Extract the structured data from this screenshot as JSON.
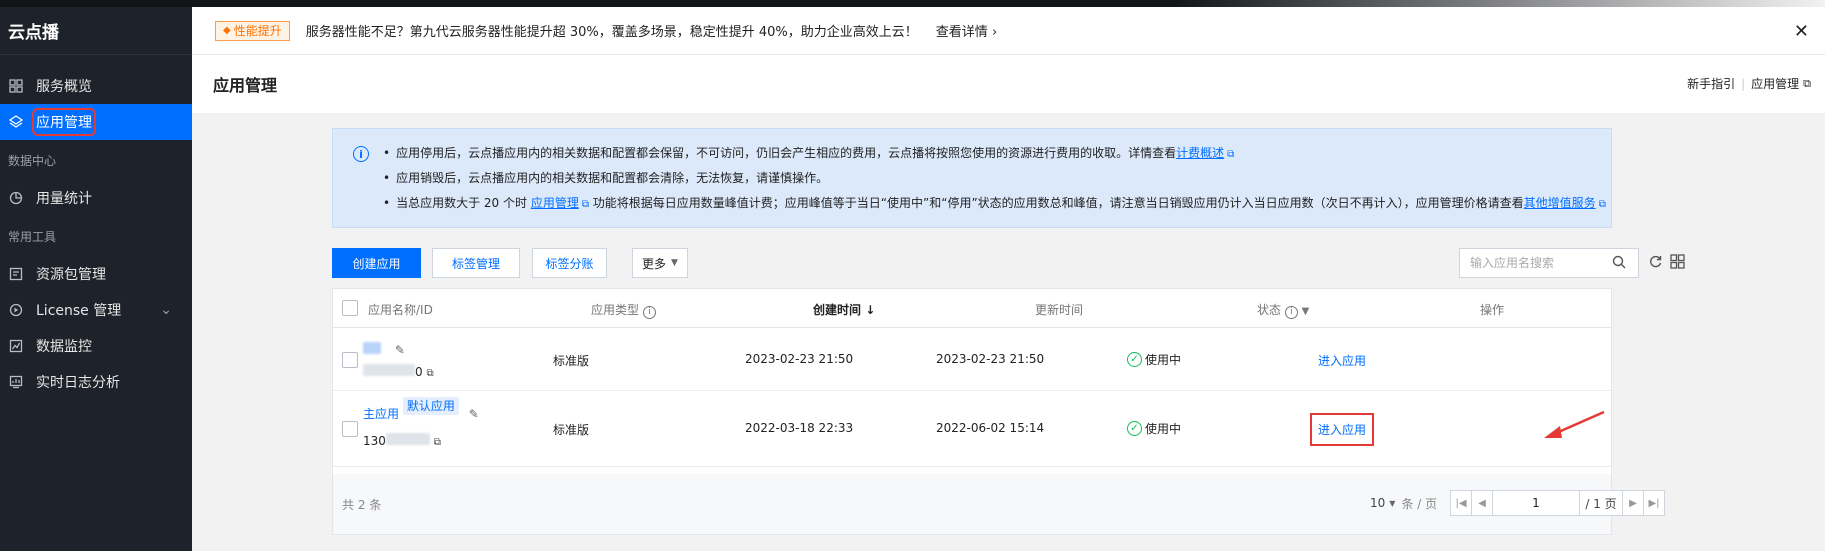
{
  "sidebar": {
    "brand": "云点播",
    "items": [
      {
        "label": "服务概览",
        "icon": "grid-icon"
      },
      {
        "label": "应用管理",
        "icon": "layers-icon",
        "active": true
      }
    ],
    "group_data": "数据中心",
    "data_items": [
      {
        "label": "用量统计",
        "icon": "pie-icon"
      }
    ],
    "group_tools": "常用工具",
    "tool_items": [
      {
        "label": "资源包管理",
        "icon": "package-icon"
      },
      {
        "label": "License 管理",
        "icon": "license-icon"
      },
      {
        "label": "数据监控",
        "icon": "monitor-icon"
      },
      {
        "label": "实时日志分析",
        "icon": "log-icon"
      }
    ]
  },
  "banner": {
    "badge": "性能提升",
    "message": "服务器性能不足？第九代云服务器性能提升超 30%，覆盖多场景，稳定性提升 40%，助力企业高效上云！",
    "detail": "查看详情",
    "close": "✕"
  },
  "header": {
    "title": "应用管理",
    "link_guide": "新手指引",
    "link_manage": "应用管理"
  },
  "notice": {
    "line1_text": "应用停用后，云点播应用内的相关数据和配置都会保留，不可访问，仍旧会产生相应的费用，云点播将按照您使用的资源进行费用的收取。详情查看",
    "line1_link": "计费概述",
    "line2_text": "应用销毁后，云点播应用内的相关数据和配置都会清除，无法恢复，请谨慎操作。",
    "line3_text_a": "当总应用数大于 20 个时",
    "line3_link_a": "应用管理",
    "line3_text_b": "功能将根据每日应用数量峰值计费；应用峰值等于当日“使用中”和“停用”状态的应用数总和峰值，请注意当日销毁应用仍计入当日应用数（次日不再计入），应用管理价格请查看",
    "line3_link_b": "其他增值服务"
  },
  "toolbar": {
    "create": "创建应用",
    "tag_manage": "标签管理",
    "tag_bill": "标签分账",
    "more": "更多",
    "search_placeholder": "输入应用名搜索"
  },
  "table": {
    "columns": [
      "应用名称/ID",
      "应用类型",
      "创建时间",
      "更新时间",
      "状态",
      "操作"
    ],
    "rows": [
      {
        "name": "",
        "id_suffix": "0",
        "type": "标准版",
        "created": "2023-02-23 21:50",
        "updated": "2023-02-23 21:50",
        "status": "使用中",
        "action": "进入应用"
      },
      {
        "name": "主应用",
        "tag": "默认应用",
        "id_prefix": "130",
        "type": "标准版",
        "created": "2022-03-18 22:33",
        "updated": "2022-06-02 15:14",
        "status": "使用中",
        "action": "进入应用"
      }
    ],
    "total_prefix": "共",
    "total_count": "2",
    "total_suffix": "条",
    "page_size": "10",
    "page_size_unit": "条 / 页",
    "page_current": "1",
    "page_total": "/ 1 页"
  },
  "colors": {
    "primary": "#006eff",
    "sidebar_bg": "#1e222a",
    "status_ok": "#0abf5b",
    "highlight": "#e53935"
  }
}
